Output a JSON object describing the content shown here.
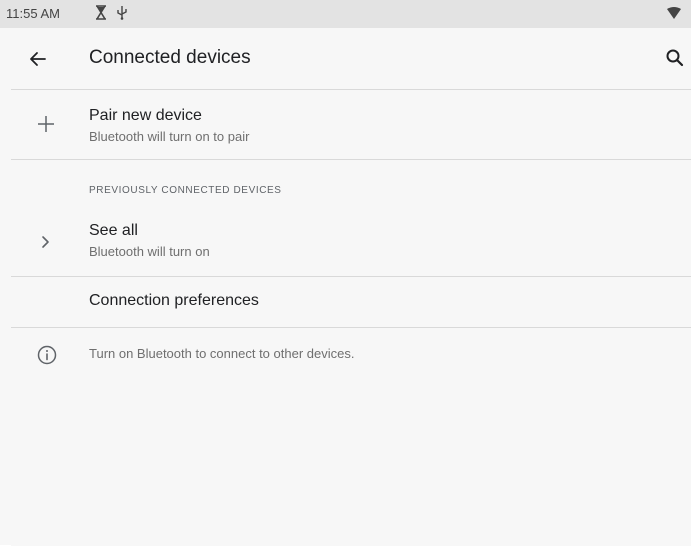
{
  "status_bar": {
    "time": "11:55 AM",
    "icons": [
      "hourglass-icon",
      "usb-icon",
      "wifi-icon"
    ]
  },
  "app_bar": {
    "title": "Connected devices",
    "back_icon": "arrow-back-icon",
    "search_icon": "search-icon"
  },
  "pair_new_device": {
    "title": "Pair new device",
    "subtitle": "Bluetooth will turn on to pair",
    "icon": "plus-icon"
  },
  "previously_connected": {
    "header": "PREVIOUSLY CONNECTED DEVICES",
    "see_all": {
      "title": "See all",
      "subtitle": "Bluetooth will turn on",
      "icon": "chevron-right-icon"
    }
  },
  "connection_preferences": {
    "title": "Connection preferences"
  },
  "footer": {
    "text": "Turn on Bluetooth to connect to other devices.",
    "icon": "info-icon"
  },
  "colors": {
    "background": "#f7f7f7",
    "status_bar": "#e3e3e3",
    "primary_text": "#202124",
    "secondary_text": "#6f6f6f",
    "divider": "#d9d9d9"
  }
}
